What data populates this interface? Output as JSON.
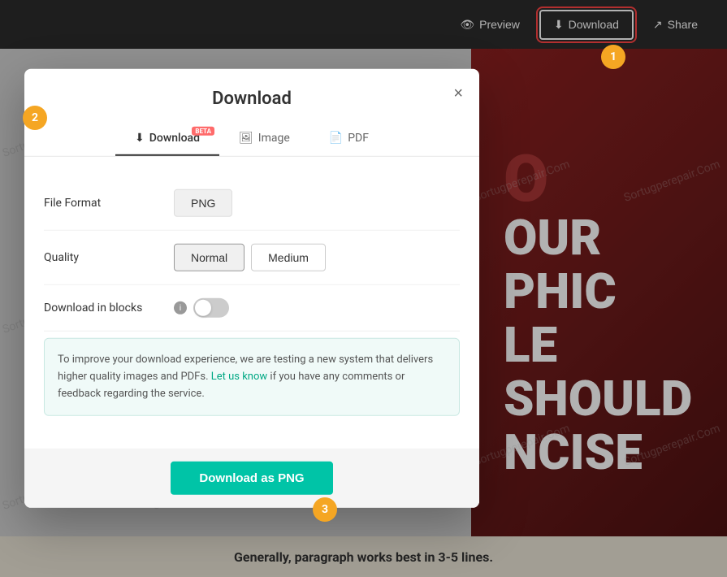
{
  "toolbar": {
    "preview_label": "Preview",
    "download_label": "Download",
    "share_label": "Share"
  },
  "dialog": {
    "title": "Download",
    "close_label": "×",
    "tabs": [
      {
        "id": "download",
        "label": "Download",
        "active": true,
        "beta": true
      },
      {
        "id": "image",
        "label": "Image",
        "active": false,
        "beta": false
      },
      {
        "id": "pdf",
        "label": "PDF",
        "active": false,
        "beta": false
      }
    ],
    "file_format_label": "File Format",
    "file_format_value": "PNG",
    "quality_label": "Quality",
    "quality_options": [
      "Normal",
      "Medium"
    ],
    "quality_selected": "Normal",
    "download_in_blocks_label": "Download in blocks",
    "info_text_part1": "To improve your download experience, we are testing a new system that delivers higher quality images and PDFs.",
    "let_us_know_label": "Let us know",
    "info_text_part2": "if you have any comments or feedback regarding the service.",
    "download_btn_label": "Download as PNG",
    "beta_label": "BETA"
  },
  "badges": {
    "badge1": "1",
    "badge2": "2",
    "badge3": "3"
  },
  "canvas": {
    "text1": "O",
    "text2": "OUR",
    "text3": "PHIC",
    "text4": "LE SHOULD",
    "text5": "NCISE",
    "footer_text": "Generally, paragraph works best in 3-5 lines."
  },
  "watermark": {
    "text": "Sortugperepair.Com"
  }
}
